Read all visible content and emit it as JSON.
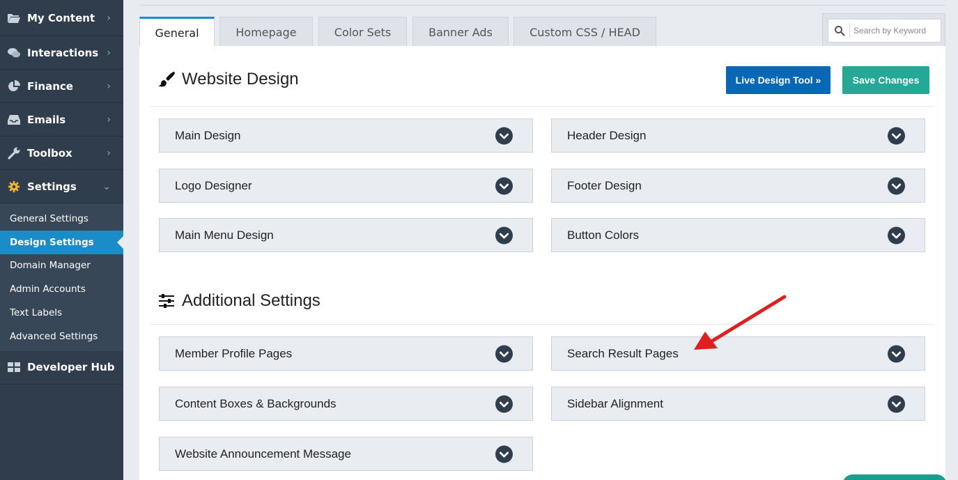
{
  "sidebar": {
    "items": [
      {
        "label": "My Content",
        "icon": "folder-open-icon"
      },
      {
        "label": "Interactions",
        "icon": "comments-icon"
      },
      {
        "label": "Finance",
        "icon": "pie-chart-icon"
      },
      {
        "label": "Emails",
        "icon": "inbox-icon"
      },
      {
        "label": "Toolbox",
        "icon": "wrench-icon"
      },
      {
        "label": "Settings",
        "icon": "gear-icon"
      }
    ],
    "settings_subitems": [
      {
        "label": "General Settings"
      },
      {
        "label": "Design Settings",
        "active": true
      },
      {
        "label": "Domain Manager"
      },
      {
        "label": "Admin Accounts"
      },
      {
        "label": "Text Labels"
      },
      {
        "label": "Advanced Settings"
      }
    ],
    "developer_hub": {
      "label": "Developer Hub",
      "icon": "grid-icon"
    }
  },
  "tabs": [
    {
      "label": "General",
      "active": true
    },
    {
      "label": "Homepage"
    },
    {
      "label": "Color Sets"
    },
    {
      "label": "Banner Ads"
    },
    {
      "label": "Custom CSS / HEAD"
    }
  ],
  "search": {
    "placeholder": "Search by Keyword",
    "value": ""
  },
  "website_design": {
    "title": "Website Design",
    "live_design_label": "Live Design Tool »",
    "save_label": "Save Changes",
    "items": [
      {
        "label": "Main Design"
      },
      {
        "label": "Header Design"
      },
      {
        "label": "Logo Designer"
      },
      {
        "label": "Footer Design"
      },
      {
        "label": "Main Menu Design"
      },
      {
        "label": "Button Colors"
      }
    ]
  },
  "additional_settings": {
    "title": "Additional Settings",
    "items": [
      {
        "label": "Member Profile Pages"
      },
      {
        "label": "Search Result Pages"
      },
      {
        "label": "Content Boxes & Backgrounds"
      },
      {
        "label": "Sidebar Alignment"
      },
      {
        "label": "Website Announcement Message"
      }
    ]
  },
  "colors": {
    "sidebar_bg": "#2f3d4d",
    "active_accent": "#1a8cc8",
    "live_design_button": "#0868b6",
    "save_button": "#23a996",
    "annotation_arrow": "#e02020"
  }
}
